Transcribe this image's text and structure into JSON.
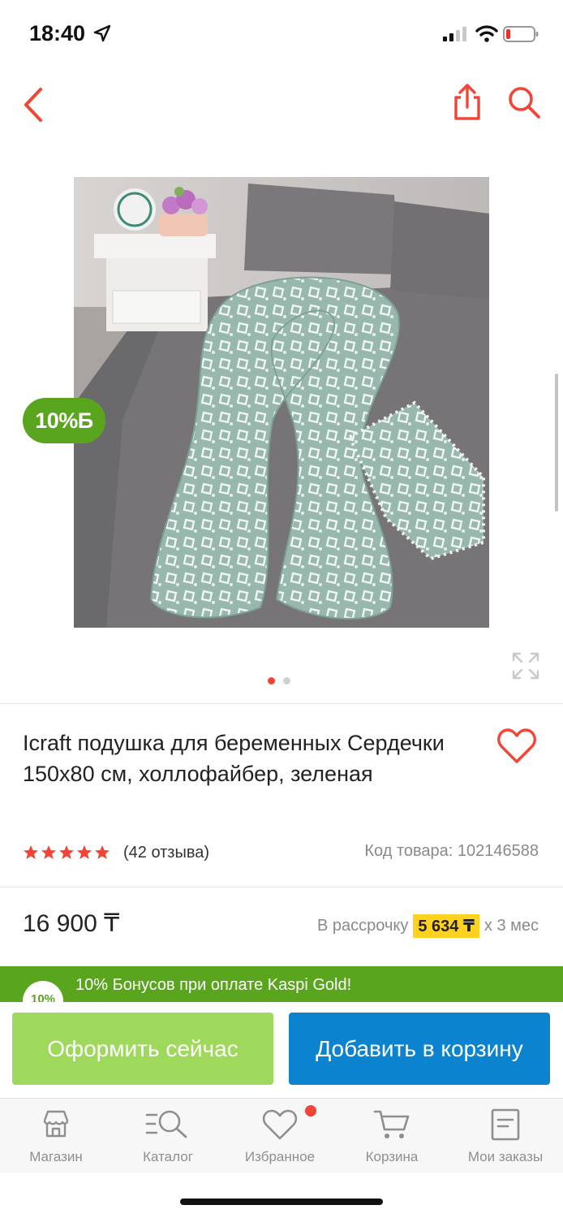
{
  "status_bar": {
    "time": "18:40"
  },
  "gallery": {
    "bonus_badge": "10%Б",
    "slides_total": 2,
    "active_slide": 1
  },
  "product": {
    "title": "Icraft подушка для беременных Сердечки 150х80 см, холлофайбер, зеленая",
    "rating": 5,
    "reviews": "(42 отзыва)",
    "sku": "Код товара: 102146588",
    "price": "16 900 ₸",
    "installment_prefix": "В рассрочку",
    "installment_amount": "5 634 ₸",
    "installment_suffix": "х 3 мес"
  },
  "bonus_bar": {
    "circle": "10%",
    "text": "10% Бонусов при оплате Kaspi Gold!"
  },
  "actions": {
    "buy_now": "Оформить сейчас",
    "add_to_cart": "Добавить в корзину"
  },
  "tabbar": {
    "items": [
      {
        "label": "Магазин",
        "icon": "shop-icon"
      },
      {
        "label": "Каталог",
        "icon": "catalog-search-icon"
      },
      {
        "label": "Избранное",
        "icon": "heart-icon"
      },
      {
        "label": "Корзина",
        "icon": "cart-icon"
      },
      {
        "label": "Мои заказы",
        "icon": "orders-icon"
      }
    ]
  },
  "colors": {
    "accent_red": "#f14635",
    "bonus_green": "#5aa51e",
    "buy_green": "#9fd95b",
    "cart_blue": "#0b83cf",
    "installment_yellow": "#ffd21f"
  }
}
